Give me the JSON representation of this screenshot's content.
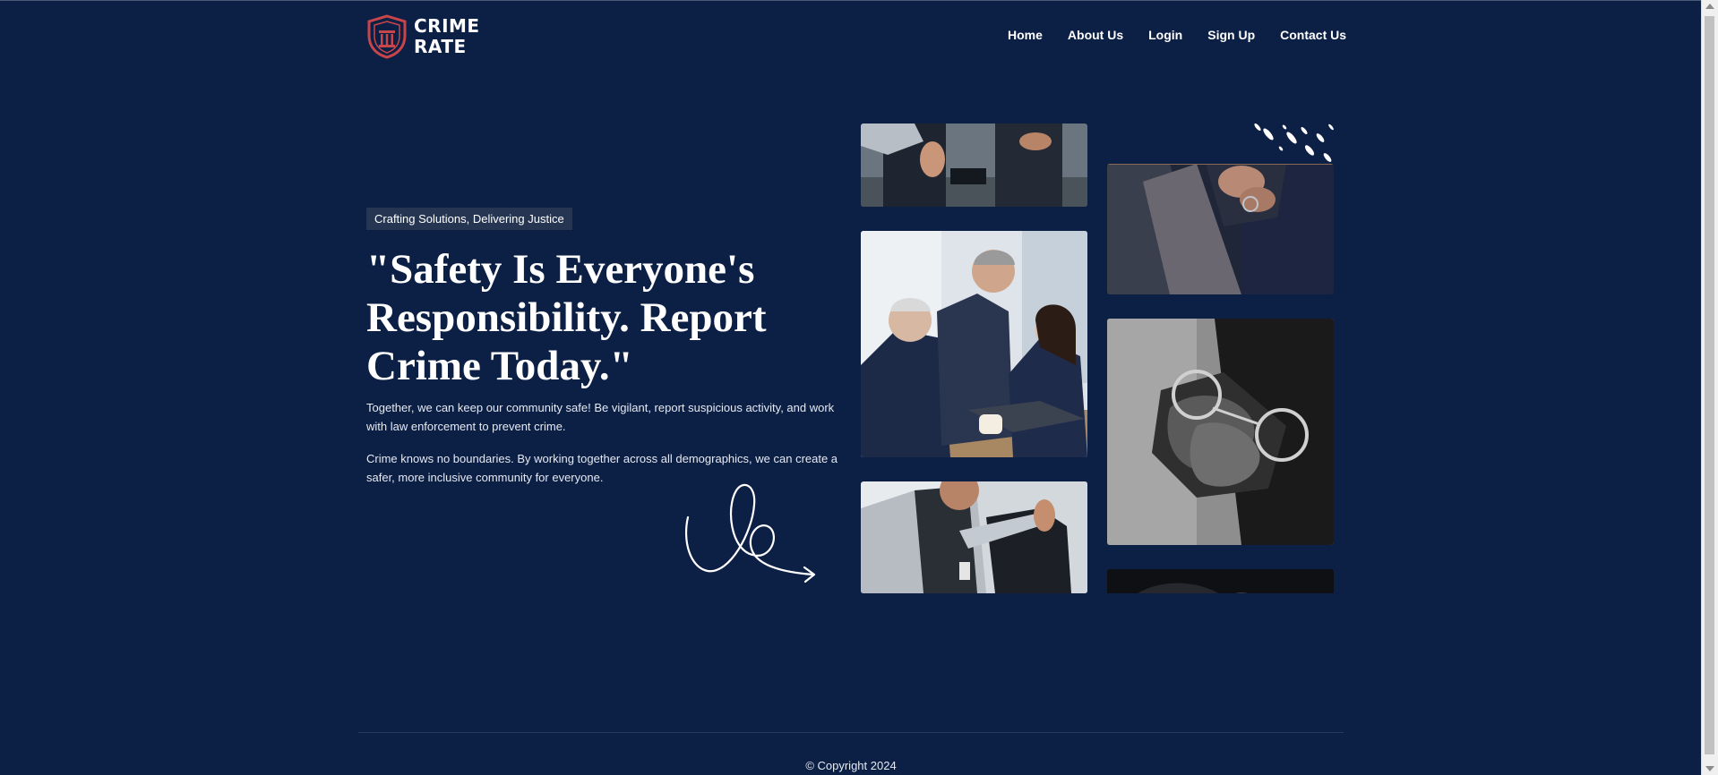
{
  "brand": {
    "name_line1": "CRIME",
    "name_line2": "RATE",
    "accent": "#c8454a",
    "bg": "#0c1f45"
  },
  "nav": {
    "home": "Home",
    "about": "About Us",
    "login": "Login",
    "signup": "Sign Up",
    "contact": "Contact Us"
  },
  "hero": {
    "tagline": "Crafting Solutions, Delivering Justice",
    "headline": "\"Safety Is Everyone's Responsibility. Report Crime Today.\"",
    "paragraph1": "Together, we can keep our community safe! Be vigilant, report suspicious activity, and work with law enforcement to prevent crime.",
    "paragraph2": "Crime knows no boundaries. By working together across all demographics, we can create a safer, more inclusive community for everyone."
  },
  "gallery": {
    "images": [
      "police-officers-photo",
      "business-meeting-photo",
      "police-arrest-photo",
      "handcuffed-hands-photo",
      "handcuffs-closeup-photo",
      "partial-photo"
    ]
  },
  "footer": {
    "copyright": "© Copyright 2024"
  }
}
